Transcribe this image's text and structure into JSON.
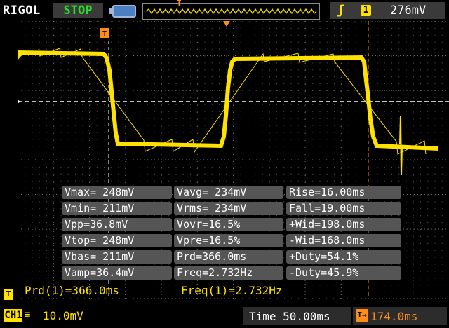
{
  "header": {
    "brand": "RIGOL",
    "run_status": "STOP",
    "trigger_level": "276mV",
    "trigger_channel": "1",
    "icons": {
      "battery": "battery-icon",
      "edge": "rising-edge-icon"
    }
  },
  "measurements": [
    [
      "Vmax= 248mV",
      "Vavg= 234mV",
      "Rise=16.00ms"
    ],
    [
      "Vmin= 211mV",
      "Vrms= 234mV",
      "Fall=19.00ms"
    ],
    [
      "Vpp=36.8mV",
      "Vovr=16.5%",
      "+Wid=198.0ms"
    ],
    [
      "Vtop= 248mV",
      "Vpre=16.5%",
      "-Wid=168.0ms"
    ],
    [
      "Vbas= 211mV",
      "Prd=366.0ms",
      "+Duty=54.1%"
    ],
    [
      "Vamp=36.4mV",
      "Freq=2.732Hz",
      "-Duty=45.9%"
    ]
  ],
  "counters": {
    "period": "Prd(1)=366.0ms",
    "frequency": "Freq(1)=2.732Hz"
  },
  "footer": {
    "channel": "CH1",
    "channel_scale": "10.0mV",
    "timebase": "Time 50.00ms",
    "trigger_offset": "174.0ms"
  },
  "colors": {
    "trace": "#ffe100",
    "accent": "#ff8c1a",
    "run_status": "#27e027",
    "panel": "#555555"
  }
}
